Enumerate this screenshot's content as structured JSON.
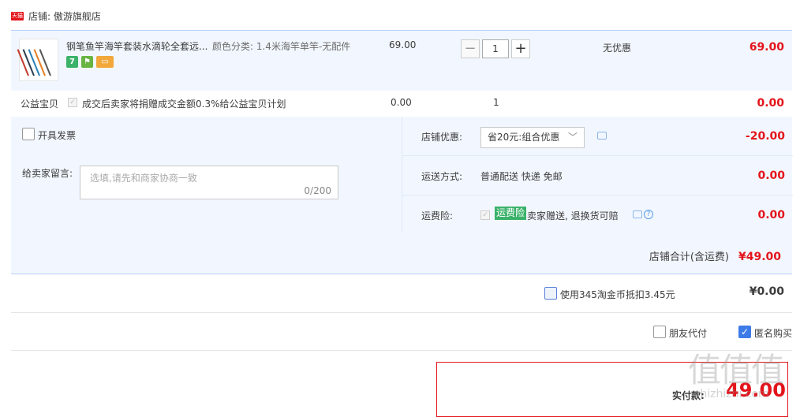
{
  "store": {
    "badge": "天猫",
    "label": "店铺: 傲游旗舰店"
  },
  "item": {
    "title": "钢笔鱼竿海竿套装水滴轮全套远...",
    "sku": "颜色分类: 1.4米海竿单竿-无配件",
    "price": "69.00",
    "quantity": "1",
    "minus": "−",
    "plus": "+",
    "discount": "无优惠",
    "total": "69.00",
    "service_icons": [
      "seven-day-return-icon",
      "guarantee-icon",
      "card-icon"
    ],
    "svc_7": "7"
  },
  "charity": {
    "label": "公益宝贝",
    "text": "成交后卖家将捐赠成交金额0.3%给公益宝贝计划",
    "price": "0.00",
    "qty": "1",
    "total": "0.00"
  },
  "invoice": {
    "label": "开具发票"
  },
  "message": {
    "label": "给卖家留言:",
    "placeholder": "选填,请先和商家协商一致",
    "counter": "0/200"
  },
  "store_discount": {
    "label": "店铺优惠:",
    "selected": "省20元:组合优惠",
    "amount": "-20.00"
  },
  "shipping": {
    "label": "运送方式:",
    "value": "普通配送 快递 免邮",
    "amount": "0.00"
  },
  "insurance": {
    "label": "运费险:",
    "badge": "运费险",
    "text": "卖家赠送, 退换货可赔",
    "amount": "0.00",
    "help": "?"
  },
  "store_total": {
    "label": "店铺合计(含运费)",
    "amount": "¥49.00"
  },
  "coins": {
    "label": "使用345淘金币抵扣3.45元",
    "amount": "¥0.00"
  },
  "payment": {
    "friend_label": "朋友代付",
    "anon_label": "匿名购买",
    "anon_checked": true
  },
  "final": {
    "label": "实付款:",
    "amount": "49.00"
  },
  "watermark": {
    "text": "值值值",
    "sub": "zhizhizhi.com"
  },
  "colors": {
    "accent_red": "#e4141b",
    "panel_blue": "#f2f7ff",
    "checkbox_blue": "#3d7ce8",
    "insurance_green": "#3bb26a"
  }
}
